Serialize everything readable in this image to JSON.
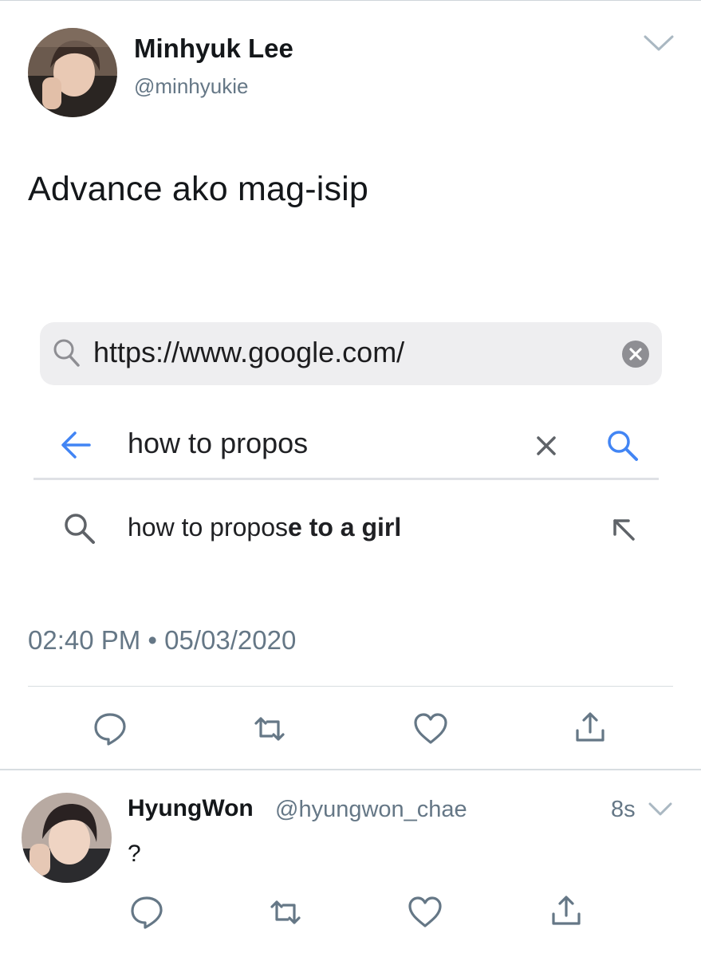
{
  "tweet": {
    "author_name": "Minhyuk Lee",
    "author_handle": "@minhyukie",
    "text": "Advance ako mag-isip",
    "timestamp": "02:40 PM • 05/03/2020"
  },
  "embedded_screenshot": {
    "url_bar": {
      "value": "https://www.google.com/"
    },
    "search_query": {
      "value": "how to propos"
    },
    "suggestion": {
      "typed_part": "how to propos",
      "completion_part": "e to a girl"
    }
  },
  "reply": {
    "author_name": "HyungWon",
    "author_handle": "@hyungwon_chae",
    "time": "8s",
    "text": "?"
  },
  "icons": {
    "more": "chevron-down-icon",
    "reply": "speech-bubble-icon",
    "retweet": "retweet-icon",
    "like": "heart-icon",
    "share": "share-icon",
    "search": "magnifier-icon",
    "clear": "clear-x-icon",
    "back": "back-arrow-icon",
    "fill_suggestion": "arrow-up-left-icon"
  },
  "colors": {
    "text_primary": "#14171a",
    "text_secondary": "#657786",
    "action_icons": "#657786",
    "google_blue": "#4285f4",
    "url_bar_bg": "#eeeef0"
  }
}
